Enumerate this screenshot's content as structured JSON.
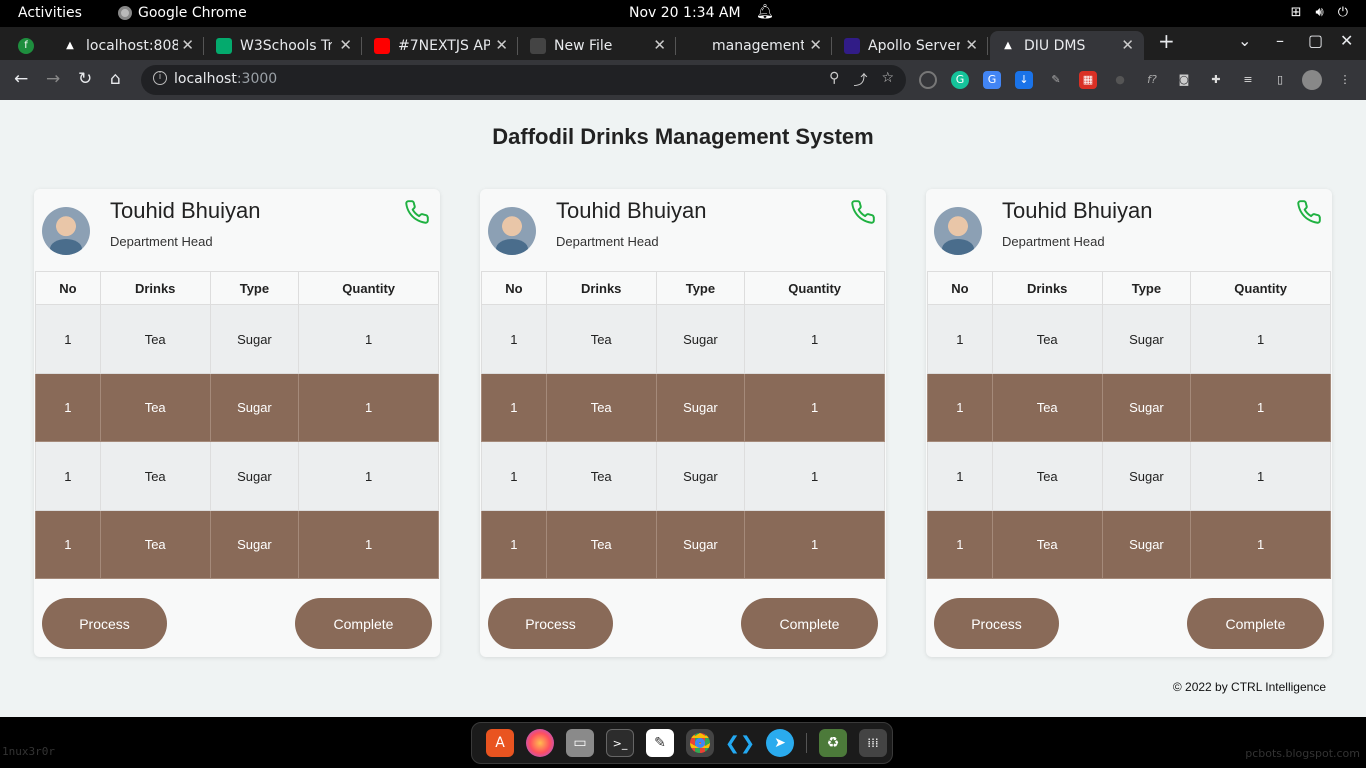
{
  "system": {
    "activities": "Activities",
    "app_name": "Google Chrome",
    "clock": "Nov 20  1:34 AM"
  },
  "tabs": [
    {
      "title": "localhost:808",
      "favicon": "triangle-icon",
      "color": "#ffffff"
    },
    {
      "title": "W3Schools Tr",
      "favicon": "w3schools-icon",
      "color": "#04aa6d"
    },
    {
      "title": "#7NEXTJS AP",
      "favicon": "youtube-icon",
      "color": "#ff0000"
    },
    {
      "title": "New File",
      "favicon": "github-icon",
      "color": "#444444"
    },
    {
      "title": "management",
      "favicon": "google-icon",
      "color": "#ffffff"
    },
    {
      "title": "Apollo Server",
      "favicon": "apollo-icon",
      "color": "#311c87"
    },
    {
      "title": "DIU DMS",
      "favicon": "triangle-icon",
      "color": "#ffffff",
      "active": true
    }
  ],
  "address_bar": {
    "host": "localhost",
    "port": ":3000"
  },
  "page": {
    "title": "Daffodil Drinks Management System",
    "footer": "© 2022 by CTRL Intelligence"
  },
  "cards": [
    {
      "name": "Touhid Bhuiyan",
      "role": "Department Head",
      "columns": [
        "No",
        "Drinks",
        "Type",
        "Quantity"
      ],
      "rows": [
        [
          "1",
          "Tea",
          "Sugar",
          "1"
        ],
        [
          "1",
          "Tea",
          "Sugar",
          "1"
        ],
        [
          "1",
          "Tea",
          "Sugar",
          "1"
        ],
        [
          "1",
          "Tea",
          "Sugar",
          "1"
        ]
      ],
      "process_label": "Process",
      "complete_label": "Complete"
    },
    {
      "name": "Touhid Bhuiyan",
      "role": "Department Head",
      "columns": [
        "No",
        "Drinks",
        "Type",
        "Quantity"
      ],
      "rows": [
        [
          "1",
          "Tea",
          "Sugar",
          "1"
        ],
        [
          "1",
          "Tea",
          "Sugar",
          "1"
        ],
        [
          "1",
          "Tea",
          "Sugar",
          "1"
        ],
        [
          "1",
          "Tea",
          "Sugar",
          "1"
        ]
      ],
      "process_label": "Process",
      "complete_label": "Complete"
    },
    {
      "name": "Touhid Bhuiyan",
      "role": "Department Head",
      "columns": [
        "No",
        "Drinks",
        "Type",
        "Quantity"
      ],
      "rows": [
        [
          "1",
          "Tea",
          "Sugar",
          "1"
        ],
        [
          "1",
          "Tea",
          "Sugar",
          "1"
        ],
        [
          "1",
          "Tea",
          "Sugar",
          "1"
        ],
        [
          "1",
          "Tea",
          "Sugar",
          "1"
        ]
      ],
      "process_label": "Process",
      "complete_label": "Complete"
    }
  ],
  "colors": {
    "accent_brown": "#896a58",
    "phone_green": "#1fb141",
    "page_bg": "#eff3f3"
  },
  "watermarks": {
    "left": "1nux3r0r",
    "right": "pcbots.blogspot.com"
  }
}
